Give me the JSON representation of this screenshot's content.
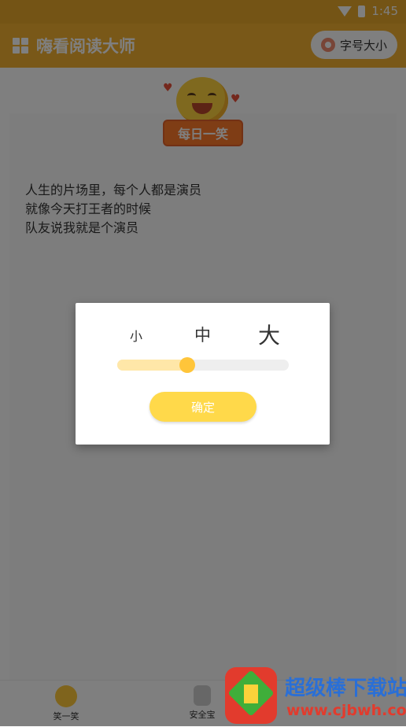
{
  "status_bar": {
    "time": "1:45"
  },
  "app_bar": {
    "title": "嗨看阅读大师",
    "font_size_button": "字号大小"
  },
  "badge": {
    "label": "每日一笑"
  },
  "joke": {
    "lines": [
      "人生的片场里，每个人都是演员",
      "就像今天打王者的时候",
      "队友说我就是个演员"
    ]
  },
  "bottom_nav": {
    "items": [
      {
        "label": "笑一笑"
      },
      {
        "label": "安全宝"
      }
    ]
  },
  "dialog": {
    "sizes": [
      "小",
      "中",
      "大"
    ],
    "slider_value": 0.4,
    "confirm_label": "确定"
  },
  "watermark": {
    "name": "超级棒下载站",
    "url": "www.cjbwh.com"
  },
  "colors": {
    "accent": "#f3b131",
    "badge": "#ff7a2a",
    "confirm": "#ffd94a"
  }
}
